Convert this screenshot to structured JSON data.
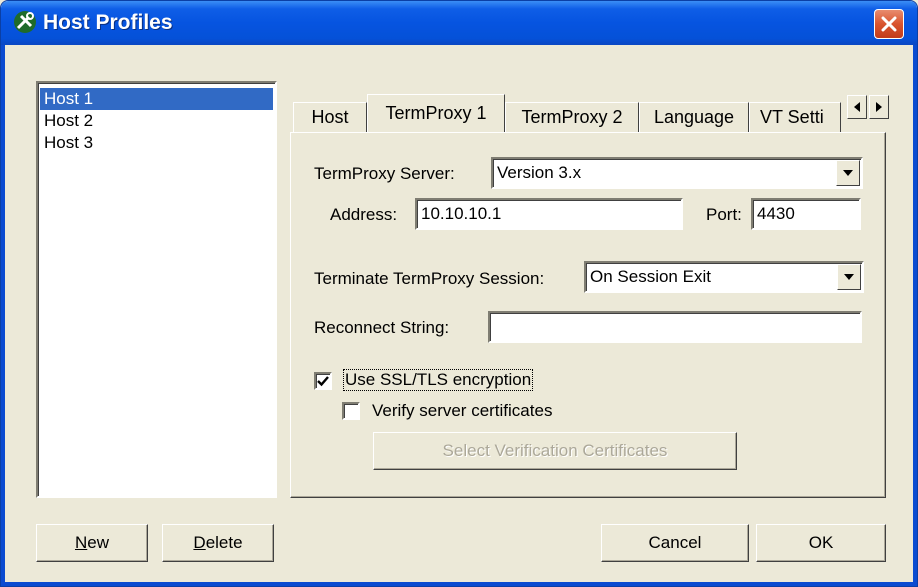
{
  "window": {
    "title": "Host Profiles"
  },
  "hosts": [
    {
      "label": "Host 1",
      "selected": true
    },
    {
      "label": "Host 2",
      "selected": false
    },
    {
      "label": "Host 3",
      "selected": false
    }
  ],
  "tabs": [
    {
      "label": "Host",
      "active": false
    },
    {
      "label": "TermProxy 1",
      "active": true
    },
    {
      "label": "TermProxy 2",
      "active": false
    },
    {
      "label": "Language",
      "active": false
    },
    {
      "label": "VT Setti",
      "active": false
    }
  ],
  "form": {
    "server_label": "TermProxy Server:",
    "server_value": "Version 3.x",
    "address_label": "Address:",
    "address_value": "10.10.10.1",
    "port_label": "Port:",
    "port_value": "4430",
    "terminate_label": "Terminate TermProxy Session:",
    "terminate_value": "On Session Exit",
    "reconnect_label": "Reconnect String:",
    "reconnect_value": "",
    "ssl_label": "Use SSL/TLS encryption",
    "ssl_checked": true,
    "verify_label": "Verify server certificates",
    "verify_checked": false,
    "select_certs_label": "Select Verification Certificates"
  },
  "buttons": {
    "new_mnemonic": "N",
    "new_rest": "ew",
    "delete_mnemonic": "D",
    "delete_rest": "elete",
    "cancel": "Cancel",
    "ok": "OK"
  }
}
